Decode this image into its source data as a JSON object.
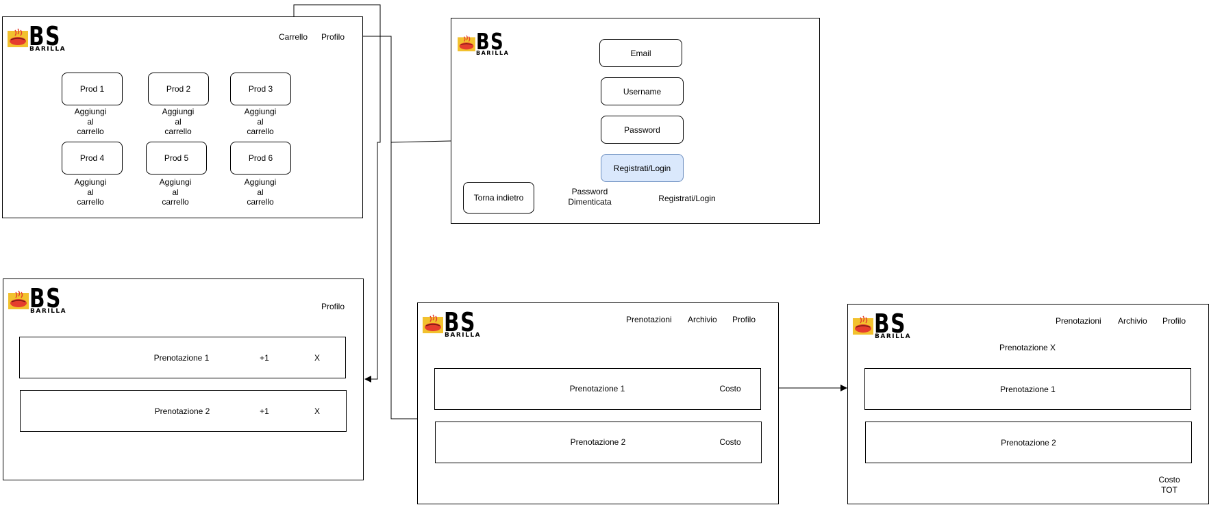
{
  "logo": {
    "letters": "BS",
    "brand": "BARILLA"
  },
  "shop": {
    "nav": {
      "cart": "Carrello",
      "profile": "Profilo"
    },
    "products": [
      {
        "name": "Prod 1",
        "action_lines": [
          "Aggiungi",
          "al",
          "carrello"
        ]
      },
      {
        "name": "Prod 2",
        "action_lines": [
          "Aggiungi",
          "al",
          "carrello"
        ]
      },
      {
        "name": "Prod 3",
        "action_lines": [
          "Aggiungi",
          "al",
          "carrello"
        ]
      },
      {
        "name": "Prod 4",
        "action_lines": [
          "Aggiungi",
          "al",
          "carrello"
        ]
      },
      {
        "name": "Prod 5",
        "action_lines": [
          "Aggiungi",
          "al",
          "carrello"
        ]
      },
      {
        "name": "Prod 6",
        "action_lines": [
          "Aggiungi",
          "al",
          "carrello"
        ]
      }
    ]
  },
  "login": {
    "email": "Email",
    "username": "Username",
    "password": "Password",
    "submit": "Registrati/Login",
    "back": "Torna indietro",
    "forgot_lines": [
      "Password",
      "Dimenticata"
    ],
    "register_link": "Registrati/Login",
    "submit_color": "#dae8fc",
    "submit_border": "#6c8ebf"
  },
  "cart": {
    "nav": {
      "profile": "Profilo"
    },
    "rows": [
      {
        "label": "Prenotazione 1",
        "plus": "+1",
        "remove": "X"
      },
      {
        "label": "Prenotazione 2",
        "plus": "+1",
        "remove": "X"
      }
    ]
  },
  "bookings": {
    "nav": {
      "bookings": "Prenotazioni",
      "archive": "Archivio",
      "profile": "Profilo"
    },
    "rows": [
      {
        "label": "Prenotazione 1",
        "cost": "Costo"
      },
      {
        "label": "Prenotazione 2",
        "cost": "Costo"
      }
    ]
  },
  "detail": {
    "nav": {
      "bookings": "Prenotazioni",
      "archive": "Archivio",
      "profile": "Profilo"
    },
    "title": "Prenotazione X",
    "rows": [
      {
        "label": "Prenotazione 1"
      },
      {
        "label": "Prenotazione 2"
      }
    ],
    "total_lines": [
      "Costo",
      "TOT"
    ]
  }
}
